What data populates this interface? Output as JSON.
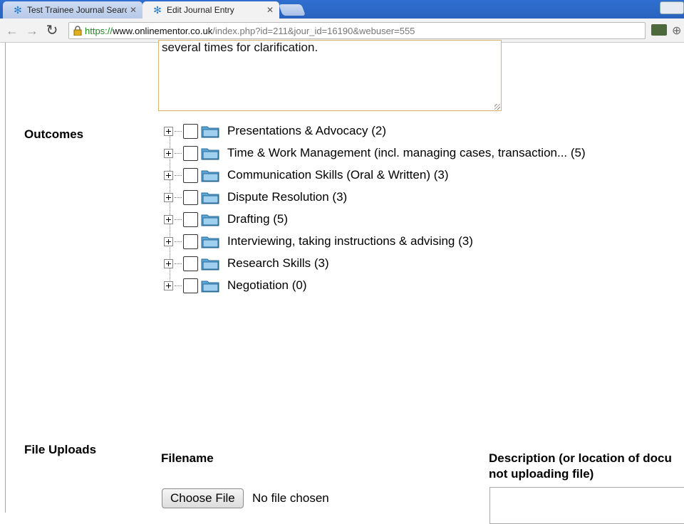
{
  "browser": {
    "tabs": [
      {
        "title": "Test Trainee Journal Search",
        "active": false
      },
      {
        "title": "Edit Journal Entry",
        "active": true
      }
    ],
    "url": {
      "scheme": "https://",
      "domain": "www.onlinementor.co.uk",
      "rest": "/index.php?id=211&jour_id=16190&webuser=555"
    }
  },
  "entry": {
    "textarea_visible_text": "several times for clarification."
  },
  "outcomes": {
    "label": "Outcomes",
    "items": [
      {
        "label": "Presentations & Advocacy (2)"
      },
      {
        "label": "Time & Work Management (incl. managing cases, transaction... (5)"
      },
      {
        "label": "Communication Skills (Oral & Written) (3)"
      },
      {
        "label": "Dispute Resolution (3)"
      },
      {
        "label": "Drafting (5)"
      },
      {
        "label": "Interviewing, taking instructions & advising (3)"
      },
      {
        "label": "Research Skills (3)"
      },
      {
        "label": "Negotiation (0)"
      }
    ]
  },
  "file_uploads": {
    "label": "File Uploads",
    "filename_header": "Filename",
    "description_header_line1": "Description (or location of docu",
    "description_header_line2": "not uploading file)",
    "choose_file_label": "Choose File",
    "no_file_text": "No file chosen"
  },
  "colors": {
    "tabbar": "#2f6fd0",
    "url_scheme": "#1a8a1a",
    "textarea_border": "#d8b26a",
    "folder": "#5aa7d8"
  }
}
